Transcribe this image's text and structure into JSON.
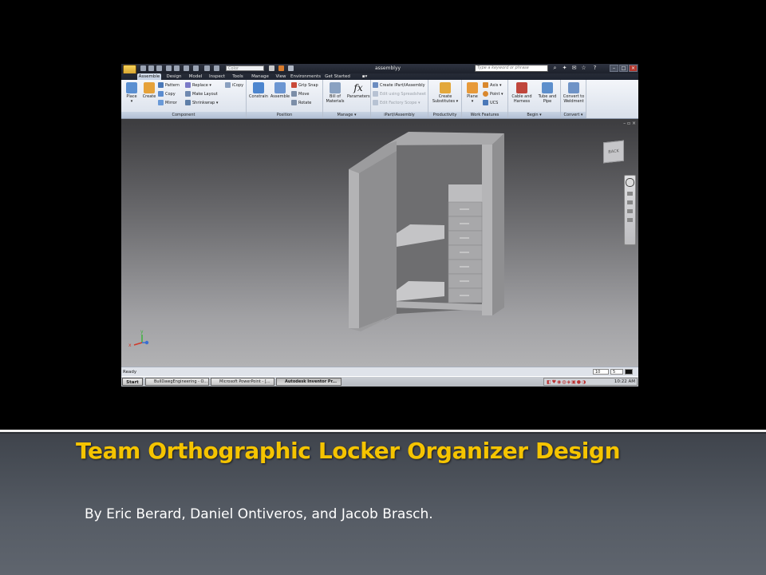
{
  "slide": {
    "title": "Team Orthographic Locker Organizer Design",
    "subtitle": "By Eric Berard, Daniel Ontiveros, and Jacob Brasch."
  },
  "app": {
    "document_title": "assemblyy",
    "color_select_value": "Color",
    "search_placeholder": "Type a keyword or phrase",
    "tabs": [
      "Assemble",
      "Design",
      "Model",
      "Inspect",
      "Tools",
      "Manage",
      "View",
      "Environments",
      "Get Started"
    ],
    "active_tab": "Assemble",
    "ribbon": {
      "component": {
        "label": "Component",
        "place": "Place",
        "create": "Create",
        "pattern": "Pattern",
        "copy": "Copy",
        "mirror": "Mirror",
        "replace": "Replace",
        "make_layout": "Make Layout",
        "shrinkwrap": "Shrinkwrap",
        "icopy": "iCopy"
      },
      "position": {
        "label": "Position",
        "constrain": "Constrain",
        "assemble": "Assemble",
        "grip_snap": "Grip Snap",
        "move": "Move",
        "rotate": "Rotate"
      },
      "manage": {
        "label": "Manage",
        "bill_line1": "Bill of",
        "bill_line2": "Materials",
        "parameters": "Parameters"
      },
      "ipart": {
        "label": "iPart/iAssembly",
        "create": "Create iPart/iAssembly",
        "edit": "Edit using Spreadsheet",
        "factory": "Edit Factory Scope"
      },
      "productivity": {
        "label": "Productivity",
        "create_line1": "Create",
        "create_line2": "Substitutes"
      },
      "work_features": {
        "label": "Work Features",
        "plane": "Plane",
        "axis": "Axis",
        "point": "Point",
        "ucs": "UCS"
      },
      "begin": {
        "label": "Begin",
        "cable_line1": "Cable and",
        "cable_line2": "Harness",
        "tube_line1": "Tube and",
        "tube_line2": "Pipe"
      },
      "convert": {
        "label": "Convert",
        "convert_line1": "Convert to",
        "convert_line2": "Weldment"
      }
    },
    "viewcube_label": "BACK",
    "status": {
      "text": "Ready",
      "val1": "10",
      "val2": "5"
    },
    "taskbar": {
      "start": "Start",
      "items": [
        "BullDawgEngineering - O...",
        "Microsoft PowerPoint - [...",
        "Autodesk Inventor Pr..."
      ],
      "active_index": 2,
      "clock": "10:22 AM"
    }
  },
  "colors": {
    "title": "#f5c400",
    "subtitle": "#ffffff",
    "slide_bottom": "#565c65",
    "viewport_top": "#3c3c3f",
    "viewport_bottom": "#b2b2b4",
    "model_grey": "#9a9a9a"
  }
}
